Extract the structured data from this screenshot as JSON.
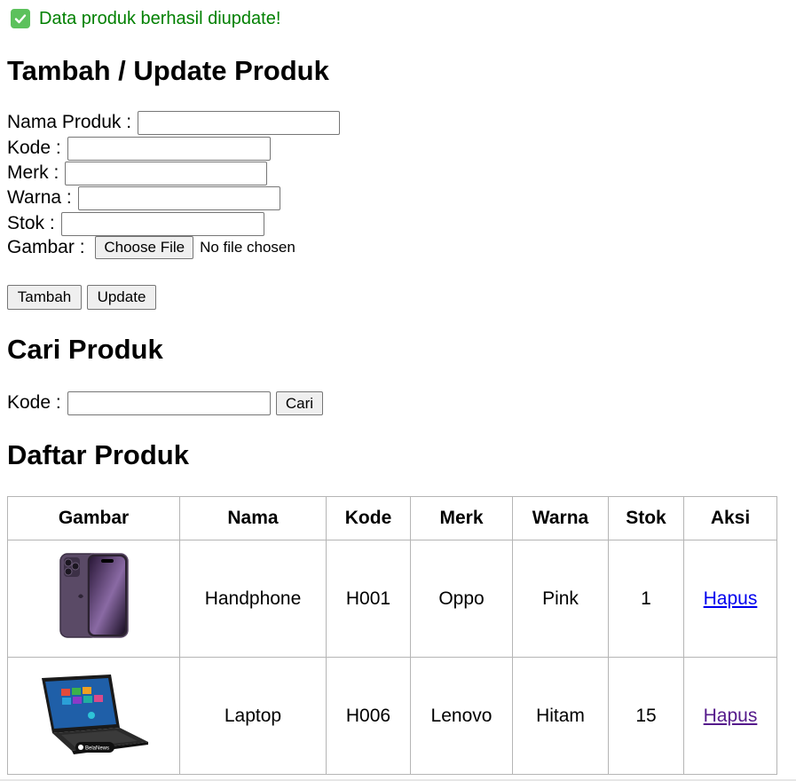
{
  "alert": {
    "message": "Data produk berhasil diupdate!",
    "icon": "check-icon",
    "color": "#008000"
  },
  "form": {
    "title": "Tambah / Update Produk",
    "nama_label": "Nama Produk : ",
    "kode_label": "Kode : ",
    "merk_label": "Merk : ",
    "warna_label": "Warna : ",
    "stok_label": "Stok : ",
    "gambar_label": "Gambar : ",
    "choose_file_label": "Choose File",
    "file_status": "No file chosen",
    "tambah_label": "Tambah",
    "update_label": "Update"
  },
  "search": {
    "title": "Cari Produk",
    "kode_label": "Kode : ",
    "cari_label": "Cari"
  },
  "list": {
    "title": "Daftar Produk",
    "headers": [
      "Gambar",
      "Nama",
      "Kode",
      "Merk",
      "Warna",
      "Stok",
      "Aksi"
    ],
    "rows": [
      {
        "image": "phone-image",
        "nama": "Handphone",
        "kode": "H001",
        "merk": "Oppo",
        "warna": "Pink",
        "stok": "1",
        "aksi": "Hapus"
      },
      {
        "image": "laptop-image",
        "nama": "Laptop",
        "kode": "H006",
        "merk": "Lenovo",
        "warna": "Hitam",
        "stok": "15",
        "aksi": "Hapus",
        "image_watermark": "BelaNews"
      }
    ]
  }
}
